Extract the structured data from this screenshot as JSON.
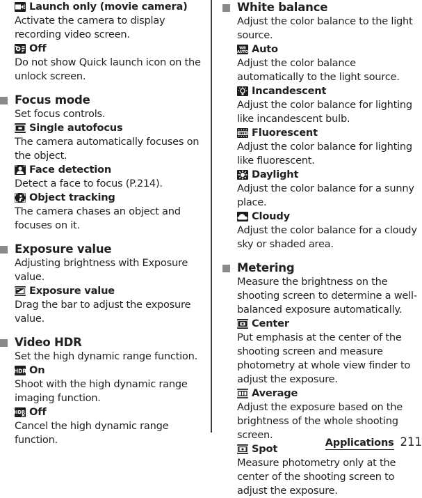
{
  "page": {
    "footer_section": "Applications",
    "page_number": "211"
  },
  "left_column": {
    "blocks": [
      {
        "type": "option",
        "icon": "movie-camera-icon",
        "label": "Launch only (movie camera)"
      },
      {
        "type": "desc",
        "text": "Activate the camera to display recording video screen."
      },
      {
        "type": "option",
        "icon": "camera-off-icon",
        "label": "Off"
      },
      {
        "type": "desc",
        "text": "Do not show Quick launch icon on the unlock screen."
      },
      {
        "type": "section",
        "title": "Focus mode"
      },
      {
        "type": "desc",
        "text": "Set focus controls."
      },
      {
        "type": "option",
        "icon": "single-autofocus-icon",
        "label": "Single autofocus"
      },
      {
        "type": "desc",
        "text": "The camera automatically focuses on the object."
      },
      {
        "type": "option",
        "icon": "face-detection-icon",
        "label": "Face detection"
      },
      {
        "type": "desc",
        "text": "Detect a face to focus (P.214)."
      },
      {
        "type": "option",
        "icon": "object-tracking-icon",
        "label": "Object tracking"
      },
      {
        "type": "desc",
        "text": "The camera chases an object and focuses on it."
      },
      {
        "type": "section",
        "title": "Exposure value"
      },
      {
        "type": "desc",
        "text": "Adjusting brightness with Exposure value."
      },
      {
        "type": "option",
        "icon": "exposure-value-icon",
        "label": "Exposure value"
      },
      {
        "type": "desc",
        "text": "Drag the bar to adjust the exposure value."
      },
      {
        "type": "section",
        "title": "Video HDR"
      },
      {
        "type": "desc",
        "text": "Set the high dynamic range function."
      },
      {
        "type": "option",
        "icon": "hdr-on-icon",
        "label": "On"
      },
      {
        "type": "desc",
        "text": "Shoot with the high dynamic range imaging function."
      },
      {
        "type": "option",
        "icon": "hdr-off-icon",
        "label": "Off"
      },
      {
        "type": "desc",
        "text": "Cancel the high dynamic range function."
      }
    ]
  },
  "right_column": {
    "blocks": [
      {
        "type": "section",
        "title": "White balance"
      },
      {
        "type": "desc",
        "text": "Adjust the color balance to the light source."
      },
      {
        "type": "option",
        "icon": "white-balance-auto-icon",
        "label": "Auto"
      },
      {
        "type": "desc",
        "text": "Adjust the color balance automatically to the light source."
      },
      {
        "type": "option",
        "icon": "incandescent-icon",
        "label": "Incandescent"
      },
      {
        "type": "desc",
        "text": "Adjust the color balance for lighting like incandescent bulb."
      },
      {
        "type": "option",
        "icon": "fluorescent-icon",
        "label": "Fluorescent"
      },
      {
        "type": "desc",
        "text": "Adjust the color balance for lighting like fluorescent."
      },
      {
        "type": "option",
        "icon": "daylight-icon",
        "label": "Daylight"
      },
      {
        "type": "desc",
        "text": "Adjust the color balance for a sunny place."
      },
      {
        "type": "option",
        "icon": "cloudy-icon",
        "label": "Cloudy"
      },
      {
        "type": "desc",
        "text": "Adjust the color balance for a cloudy sky or shaded area."
      },
      {
        "type": "section",
        "title": "Metering"
      },
      {
        "type": "desc",
        "text": "Measure the brightness on the shooting screen to determine a well-balanced exposure automatically."
      },
      {
        "type": "option",
        "icon": "metering-center-icon",
        "label": "Center"
      },
      {
        "type": "desc",
        "text": "Put emphasis at the center of the shooting screen and measure photometry at whole view finder to adjust the exposure."
      },
      {
        "type": "option",
        "icon": "metering-average-icon",
        "label": "Average"
      },
      {
        "type": "desc",
        "text": "Adjust the exposure based on the brightness of the whole shooting screen."
      },
      {
        "type": "option",
        "icon": "metering-spot-icon",
        "label": "Spot"
      },
      {
        "type": "desc",
        "text": "Measure photometry only at the center of the shooting screen to adjust the exposure."
      }
    ]
  }
}
